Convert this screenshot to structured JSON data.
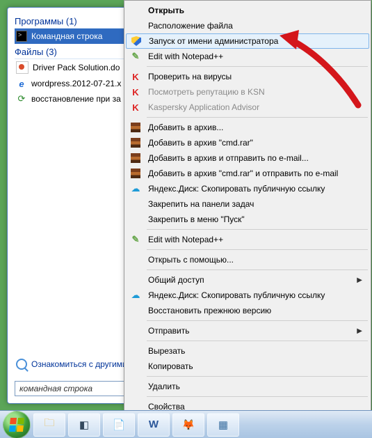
{
  "start": {
    "programs_header": "Программы",
    "programs_count": "(1)",
    "files_header": "Файлы",
    "files_count": "(3)",
    "items": {
      "cmd": "Командная строка",
      "driverpack": "Driver Pack Solution.do",
      "wordpress": "wordpress.2012-07-21.x",
      "restore": "восстановление при за"
    },
    "more_results": "Ознакомиться с другими",
    "search_value": "командная строка"
  },
  "menu": {
    "open": "Открыть",
    "file_location": "Расположение файла",
    "run_as_admin": "Запуск от имени администратора",
    "edit_npp1": "Edit with Notepad++",
    "scan": "Проверить на вирусы",
    "ksn": "Посмотреть репутацию в KSN",
    "kaspersky_adv": "Kaspersky Application Advisor",
    "add_archive": "Добавить в архив...",
    "add_archive_cmd": "Добавить в архив \"cmd.rar\"",
    "add_email": "Добавить в архив и отправить по e-mail...",
    "add_cmd_email": "Добавить в архив \"cmd.rar\" и отправить по e-mail",
    "yadisk_copy1": "Яндекс.Диск: Скопировать публичную ссылку",
    "pin_taskbar": "Закрепить на панели задач",
    "pin_start": "Закрепить в меню \"Пуск\"",
    "edit_npp2": "Edit with Notepad++",
    "open_with": "Открыть с помощью...",
    "share": "Общий доступ",
    "yadisk_copy2": "Яндекс.Диск: Скопировать публичную ссылку",
    "restore_prev": "Восстановить прежнюю версию",
    "send_to": "Отправить",
    "cut": "Вырезать",
    "copy": "Копировать",
    "delete": "Удалить",
    "properties": "Свойства"
  }
}
